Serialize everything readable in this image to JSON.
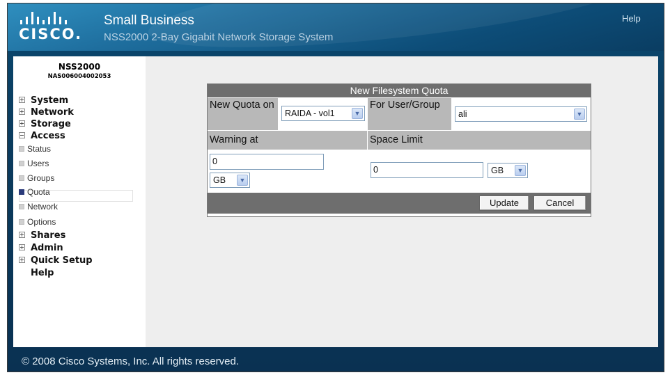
{
  "header": {
    "logo_text": "CISCO.",
    "title": "Small Business",
    "subtitle": "NSS2000 2-Bay Gigabit Network Storage System",
    "help_link": "Help"
  },
  "sidebar": {
    "device_name": "NSS2000",
    "device_serial": "NAS006004002053",
    "items": [
      {
        "label": "System",
        "type": "main",
        "expander": "plus"
      },
      {
        "label": "Network",
        "type": "main",
        "expander": "plus"
      },
      {
        "label": "Storage",
        "type": "main",
        "expander": "plus"
      },
      {
        "label": "Access",
        "type": "main",
        "expander": "minus"
      },
      {
        "label": "Status",
        "type": "sub"
      },
      {
        "label": "Users",
        "type": "sub"
      },
      {
        "label": "Groups",
        "type": "sub"
      },
      {
        "label": "Quota",
        "type": "sub",
        "active": true
      },
      {
        "label": "Network",
        "type": "sub"
      },
      {
        "label": "Options",
        "type": "sub"
      },
      {
        "label": "Shares",
        "type": "main",
        "expander": "plus"
      },
      {
        "label": "Admin",
        "type": "main",
        "expander": "plus"
      },
      {
        "label": "Quick Setup",
        "type": "main",
        "expander": "plus"
      },
      {
        "label": "Help",
        "type": "main",
        "expander": "none"
      }
    ]
  },
  "form": {
    "title": "New Filesystem Quota",
    "quota_on_label": "New Quota on",
    "quota_on_value": "RAIDA - vol1",
    "for_label": "For User/Group",
    "for_value": "ali",
    "warning_label": "Warning at",
    "warning_value": "0",
    "warning_unit": "GB",
    "limit_label": "Space Limit",
    "limit_value": "0",
    "limit_unit": "GB",
    "update_button": "Update",
    "cancel_button": "Cancel"
  },
  "footer": {
    "copyright": "© 2008 Cisco Systems, Inc. All rights reserved."
  },
  "colors": {
    "header_blue": "#1f6f9f",
    "frame_navy": "#0a3152",
    "form_title_bar": "#6e6e6e",
    "form_label_gray": "#b8b8b8",
    "active_nav": "#2a3a7a"
  }
}
